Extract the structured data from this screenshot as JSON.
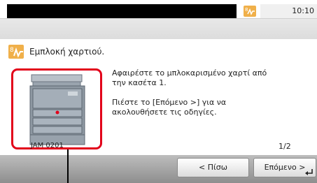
{
  "status_bar": {
    "clock": "10:10",
    "alert_icon": "paper-jam-alert-icon"
  },
  "message": {
    "title": "Εμπλοκή χαρτιού.",
    "icon": "paper-jam-icon",
    "jam_code": "JAM 0201",
    "instructions": [
      "Αφαιρέστε το μπλοκαρισμένο χαρτί από την κασέτα 1.",
      "Πιέστε το [Επόμενο >] για να ακολουθήσετε τις οδηγίες."
    ],
    "page_indicator": "1/2"
  },
  "buttons": {
    "back_label": "< Πίσω",
    "next_label": "Επόμενο >"
  },
  "colors": {
    "highlight": "#e2001a",
    "alert": "#f0b04a"
  }
}
